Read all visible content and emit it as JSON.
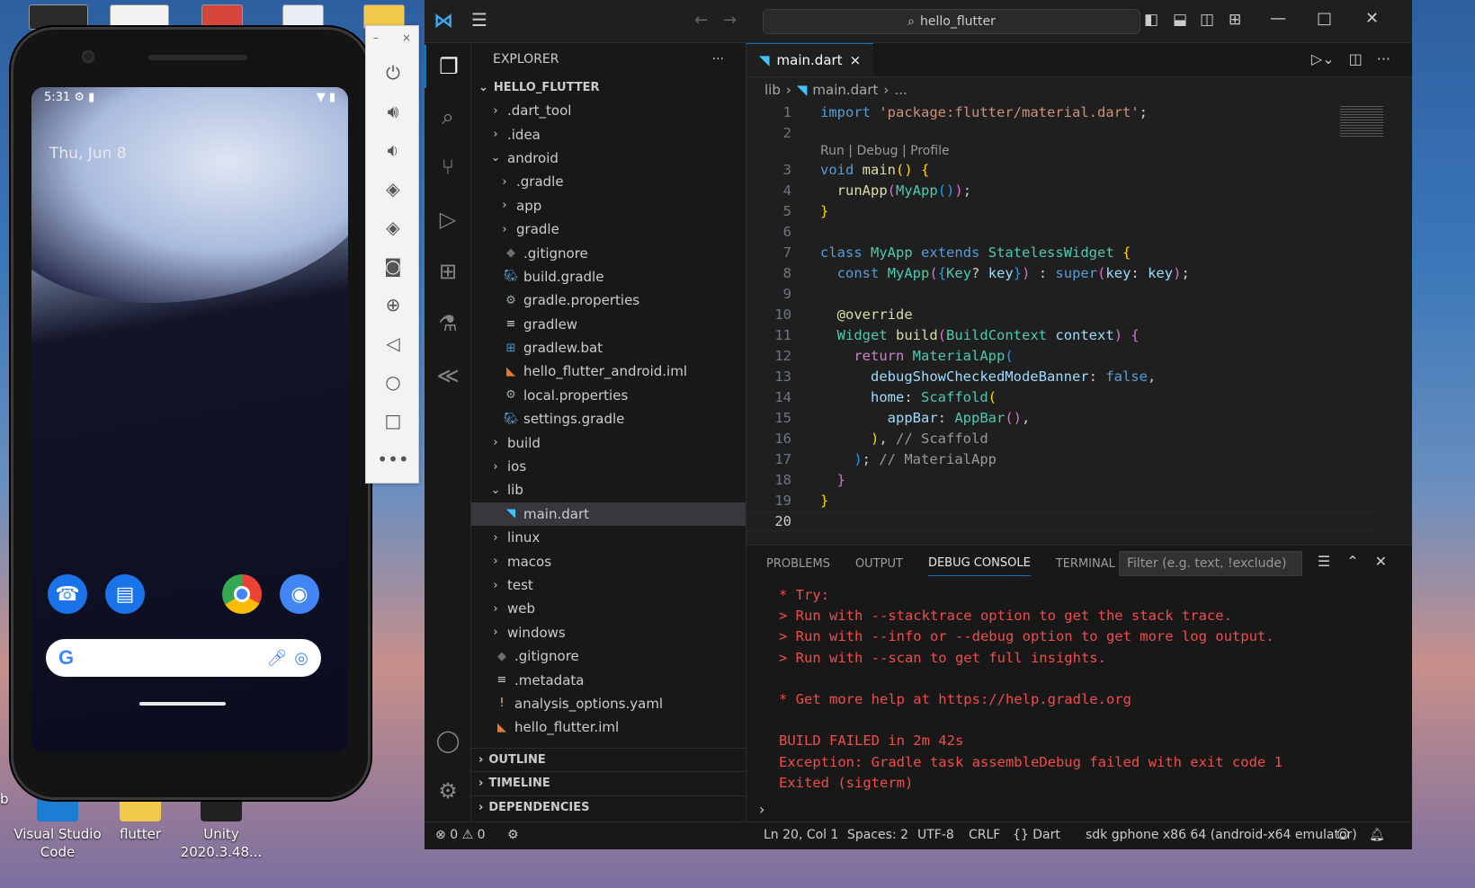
{
  "desktop": {
    "icons": [
      {
        "label": "Visual Studio Code",
        "line1": "Visual Studio",
        "line2": "Code"
      },
      {
        "label": "flutter",
        "line1": "flutter",
        "line2": ""
      },
      {
        "label": "Unity 2020.3.48...",
        "line1": "Unity",
        "line2": "2020.3.48..."
      }
    ],
    "left_edge_label": "b"
  },
  "phone": {
    "time": "5:31",
    "date": "Thu, Jun 8",
    "status_icons": [
      "gear-icon",
      "sim-icon",
      "wifi-icon",
      "battery-icon"
    ]
  },
  "emulator_toolbar": {
    "minimize": "–",
    "close": "×",
    "buttons": [
      "power",
      "volume-up",
      "volume-down",
      "rotate-left",
      "rotate-right",
      "screenshot",
      "zoom",
      "back",
      "home",
      "overview",
      "more"
    ]
  },
  "vscode": {
    "search_text": "hello_flutter",
    "sidebar": {
      "title": "EXPLORER",
      "more": "···",
      "root": "HELLO_FLUTTER",
      "tree": [
        {
          "label": ".dart_tool",
          "depth": 1,
          "kind": "folder",
          "open": false
        },
        {
          "label": ".idea",
          "depth": 1,
          "kind": "folder",
          "open": false
        },
        {
          "label": "android",
          "depth": 1,
          "kind": "folder",
          "open": true
        },
        {
          "label": ".gradle",
          "depth": 2,
          "kind": "folder",
          "open": false
        },
        {
          "label": "app",
          "depth": 2,
          "kind": "folder",
          "open": false
        },
        {
          "label": "gradle",
          "depth": 2,
          "kind": "folder",
          "open": false
        },
        {
          "label": ".gitignore",
          "depth": 2,
          "kind": "git"
        },
        {
          "label": "build.gradle",
          "depth": 2,
          "kind": "gradle"
        },
        {
          "label": "gradle.properties",
          "depth": 2,
          "kind": "settings"
        },
        {
          "label": "gradlew",
          "depth": 2,
          "kind": "text"
        },
        {
          "label": "gradlew.bat",
          "depth": 2,
          "kind": "windows"
        },
        {
          "label": "hello_flutter_android.iml",
          "depth": 2,
          "kind": "rss"
        },
        {
          "label": "local.properties",
          "depth": 2,
          "kind": "settings"
        },
        {
          "label": "settings.gradle",
          "depth": 2,
          "kind": "gradle"
        },
        {
          "label": "build",
          "depth": 1,
          "kind": "folder",
          "open": false
        },
        {
          "label": "ios",
          "depth": 1,
          "kind": "folder",
          "open": false
        },
        {
          "label": "lib",
          "depth": 1,
          "kind": "folder",
          "open": true
        },
        {
          "label": "main.dart",
          "depth": 2,
          "kind": "dart",
          "selected": true
        },
        {
          "label": "linux",
          "depth": 1,
          "kind": "folder",
          "open": false
        },
        {
          "label": "macos",
          "depth": 1,
          "kind": "folder",
          "open": false
        },
        {
          "label": "test",
          "depth": 1,
          "kind": "folder",
          "open": false
        },
        {
          "label": "web",
          "depth": 1,
          "kind": "folder",
          "open": false
        },
        {
          "label": "windows",
          "depth": 1,
          "kind": "folder",
          "open": false
        },
        {
          "label": ".gitignore",
          "depth": 1,
          "kind": "git"
        },
        {
          "label": ".metadata",
          "depth": 1,
          "kind": "text"
        },
        {
          "label": "analysis_options.yaml",
          "depth": 1,
          "kind": "yaml"
        },
        {
          "label": "hello_flutter.iml",
          "depth": 1,
          "kind": "rss"
        }
      ],
      "sections": [
        "OUTLINE",
        "TIMELINE",
        "DEPENDENCIES"
      ]
    },
    "editor": {
      "tab_label": "main.dart",
      "tab_close": "×",
      "breadcrumb": {
        "folder": "lib",
        "file": "main.dart",
        "rest": "..."
      },
      "codelens": "Run | Debug | Profile",
      "line_numbers": [
        "1",
        "2",
        "3",
        "4",
        "5",
        "6",
        "7",
        "8",
        "9",
        "10",
        "11",
        "12",
        "13",
        "14",
        "15",
        "16",
        "17",
        "18",
        "19",
        "20"
      ]
    },
    "panel": {
      "tabs": [
        "PROBLEMS",
        "OUTPUT",
        "DEBUG CONSOLE",
        "TERMINAL"
      ],
      "active_tab": "DEBUG CONSOLE",
      "filter_placeholder": "Filter (e.g. text, !exclude)",
      "console_lines": [
        "* Try:",
        "> Run with --stacktrace option to get the stack trace.",
        "> Run with --info or --debug option to get more log output.",
        "> Run with --scan to get full insights.",
        "",
        "* Get more help at https://help.gradle.org",
        "",
        "BUILD FAILED in 2m 42s",
        "Exception: Gradle task assembleDebug failed with exit code 1",
        "Exited (sigterm)"
      ]
    },
    "statusbar": {
      "errors": "0",
      "warnings": "0",
      "position": "Ln 20, Col 1",
      "spaces": "Spaces: 2",
      "encoding": "UTF-8",
      "eol": "CRLF",
      "language": "Dart",
      "device": "sdk gphone x86 64 (android-x64 emulator)"
    },
    "colors": {
      "accent": "#0078d4",
      "error": "#f14c4c",
      "editor_bg": "#1f1f1f"
    }
  }
}
